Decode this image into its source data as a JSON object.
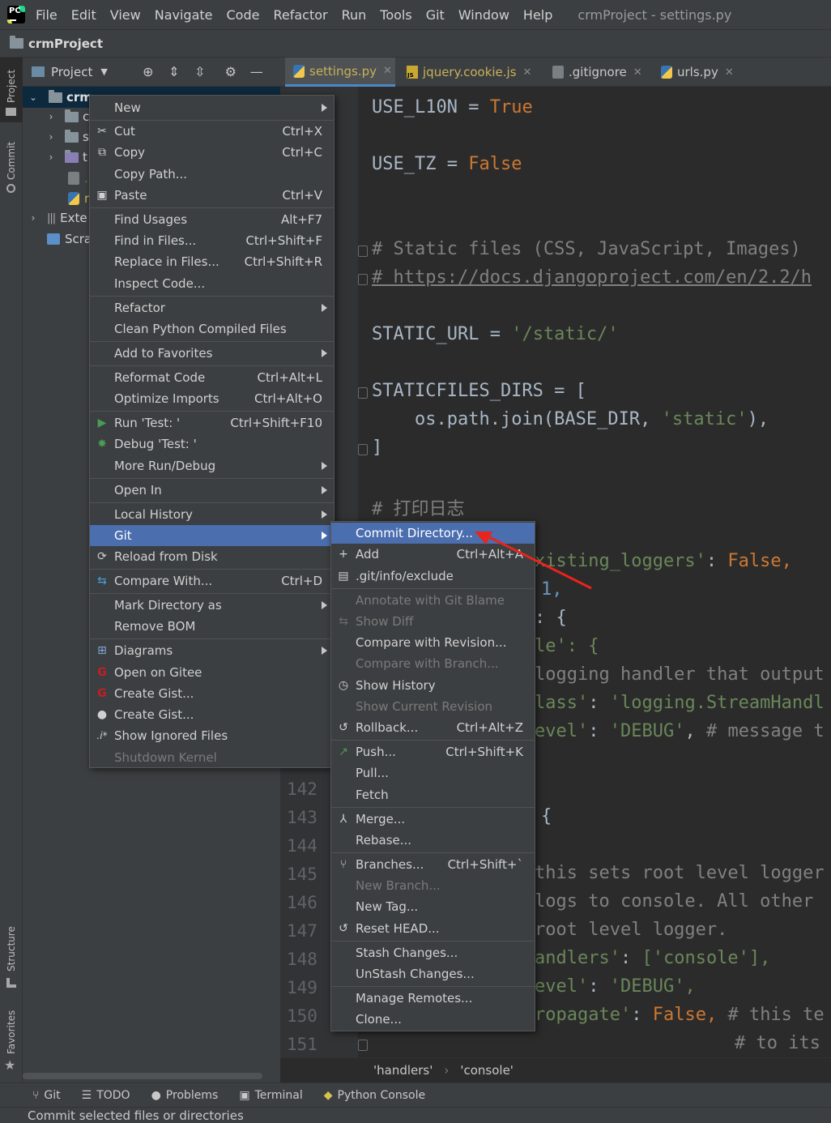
{
  "menubar": {
    "items": [
      "File",
      "Edit",
      "View",
      "Navigate",
      "Code",
      "Refactor",
      "Run",
      "Tools",
      "Git",
      "Window",
      "Help"
    ],
    "window_title": "crmProject - settings.py"
  },
  "project_bar": {
    "name": "crmProject"
  },
  "left_strip": {
    "project": "Project",
    "commit": "Commit",
    "structure": "Structure",
    "favorites": "Favorites"
  },
  "project_panel": {
    "title": "Project",
    "tree": [
      {
        "label": "crm",
        "indent": 0,
        "expanded": true
      },
      {
        "label": "c",
        "indent": 1
      },
      {
        "label": "s",
        "indent": 1
      },
      {
        "label": "t",
        "indent": 1
      },
      {
        "label": ".",
        "indent": 1
      },
      {
        "label": "r",
        "indent": 1
      },
      {
        "label": "Exte",
        "indent": 0
      },
      {
        "label": "Scra",
        "indent": 0
      }
    ]
  },
  "editor_tabs": [
    {
      "label": "settings.py",
      "active": true
    },
    {
      "label": "jquery.cookie.js"
    },
    {
      "label": ".gitignore"
    },
    {
      "label": "urls.py"
    }
  ],
  "code": {
    "use_l10n_name": "USE_L10N",
    "use_l10n_val": "True",
    "use_tz_name": "USE_TZ",
    "use_tz_val": "False",
    "static_comment": "# Static files (CSS, JavaScript, Images)",
    "url_comment": "# https://docs.djangoproject.com/en/2.2/h",
    "static_url_name": "STATIC_URL",
    "static_url_val": "'/static/'",
    "staticfiles_name": "STATICFILES_DIRS",
    "join_call": "os.path.join(BASE_DIR, ",
    "join_arg": "'static'",
    "log_comment": "# 打印日志",
    "r1": "xisting_loggers'",
    "r1b": "False,",
    "r2": "1,",
    "r3": ": {",
    "r4": "le': {",
    "r5": "logging handler that output",
    "r6a": "lass'",
    "r6b": "'logging.StreamHandl",
    "r7a": "evel'",
    "r7b": "'DEBUG'",
    "r7c": "# message t",
    "r9": "{",
    "r10": "this sets root level logger",
    "r11": "logs to console. All other",
    "r12": "root level logger.",
    "r13a": "andlers'",
    "r13b": "['console'],",
    "r14a": "evel'",
    "r14b": "'DEBUG',",
    "r15a": "ropagate'",
    "r15b": "False,",
    "r15c": "# this te",
    "r16": "# to its"
  },
  "line_numbers": [
    "142",
    "143",
    "144",
    "145",
    "146",
    "147",
    "148",
    "149",
    "150",
    "151"
  ],
  "breadcrumb": [
    "'handlers'",
    "'console'"
  ],
  "context_menu": {
    "new": "New",
    "cut": "Cut",
    "cut_sc": "Ctrl+X",
    "copy": "Copy",
    "copy_sc": "Ctrl+C",
    "copy_path": "Copy Path...",
    "paste": "Paste",
    "paste_sc": "Ctrl+V",
    "find_usages": "Find Usages",
    "find_usages_sc": "Alt+F7",
    "find_in_files": "Find in Files...",
    "find_in_files_sc": "Ctrl+Shift+F",
    "replace_in_files": "Replace in Files...",
    "replace_in_files_sc": "Ctrl+Shift+R",
    "inspect_code": "Inspect Code...",
    "refactor": "Refactor",
    "clean_python": "Clean Python Compiled Files",
    "add_favorites": "Add to Favorites",
    "reformat": "Reformat Code",
    "reformat_sc": "Ctrl+Alt+L",
    "optimize": "Optimize Imports",
    "optimize_sc": "Ctrl+Alt+O",
    "run": "Run 'Test: '",
    "run_sc": "Ctrl+Shift+F10",
    "debug": "Debug 'Test: '",
    "more_run": "More Run/Debug",
    "open_in": "Open In",
    "local_history": "Local History",
    "git": "Git",
    "reload": "Reload from Disk",
    "compare_with": "Compare With...",
    "compare_with_sc": "Ctrl+D",
    "mark_dir": "Mark Directory as",
    "remove_bom": "Remove BOM",
    "diagrams": "Diagrams",
    "open_gitee": "Open on Gitee",
    "create_gist_gitee": "Create Gist...",
    "create_gist_github": "Create Gist...",
    "show_ignored": "Show Ignored Files",
    "shutdown_kernel": "Shutdown Kernel"
  },
  "git_submenu": {
    "commit_dir": "Commit Directory...",
    "add": "Add",
    "add_sc": "Ctrl+Alt+A",
    "exclude": ".git/info/exclude",
    "annotate": "Annotate with Git Blame",
    "show_diff": "Show Diff",
    "compare_revision": "Compare with Revision...",
    "compare_branch": "Compare with Branch...",
    "show_history": "Show History",
    "show_current_revision": "Show Current Revision",
    "rollback": "Rollback...",
    "rollback_sc": "Ctrl+Alt+Z",
    "push": "Push...",
    "push_sc": "Ctrl+Shift+K",
    "pull": "Pull...",
    "fetch": "Fetch",
    "merge": "Merge...",
    "rebase": "Rebase...",
    "branches": "Branches...",
    "branches_sc": "Ctrl+Shift+`",
    "new_branch": "New Branch...",
    "new_tag": "New Tag...",
    "reset_head": "Reset HEAD...",
    "stash": "Stash Changes...",
    "unstash": "UnStash Changes...",
    "manage_remotes": "Manage Remotes...",
    "clone": "Clone..."
  },
  "bottom_tools": [
    "Git",
    "TODO",
    "Problems",
    "Terminal",
    "Python Console"
  ],
  "status": "Commit selected files or directories"
}
